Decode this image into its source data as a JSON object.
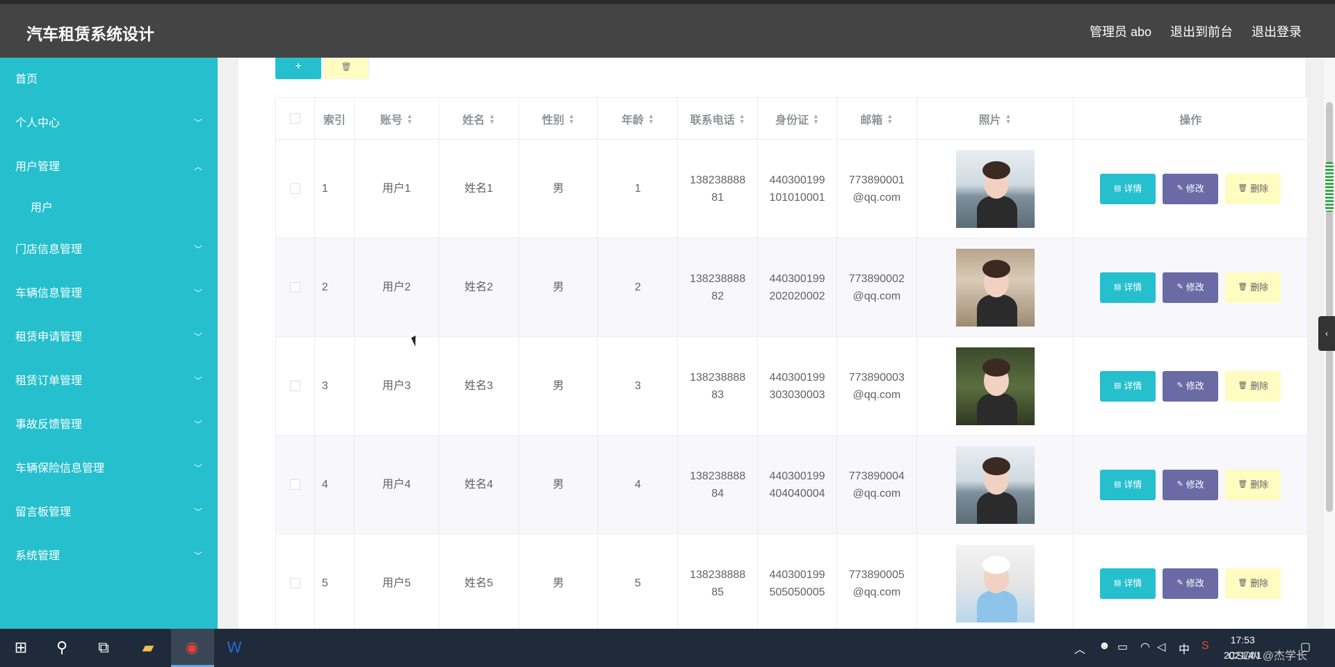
{
  "header": {
    "title": "汽车租赁系统设计",
    "nav": [
      "管理员 abo",
      "退出到前台",
      "退出登录"
    ]
  },
  "sidebar": {
    "items": [
      {
        "label": "首页",
        "chevron": ""
      },
      {
        "label": "个人中心",
        "chevron": "down"
      },
      {
        "label": "用户管理",
        "chevron": "up"
      },
      {
        "label": "用户",
        "chevron": "",
        "sub": true
      },
      {
        "label": "门店信息管理",
        "chevron": "down"
      },
      {
        "label": "车辆信息管理",
        "chevron": "down"
      },
      {
        "label": "租赁申请管理",
        "chevron": "down"
      },
      {
        "label": "租赁订单管理",
        "chevron": "down"
      },
      {
        "label": "事故反馈管理",
        "chevron": "down"
      },
      {
        "label": "车辆保险信息管理",
        "chevron": "down"
      },
      {
        "label": "留言板管理",
        "chevron": "down"
      },
      {
        "label": "系统管理",
        "chevron": "down"
      }
    ]
  },
  "toolbar": {
    "add_label": "+",
    "delete_icon": "trash-icon"
  },
  "table": {
    "columns": [
      "",
      "索引",
      "账号",
      "姓名",
      "性别",
      "年龄",
      "联系电话",
      "身份证",
      "邮箱",
      "照片",
      "操作"
    ],
    "sortable": [
      false,
      false,
      true,
      true,
      true,
      true,
      true,
      true,
      true,
      true,
      false
    ],
    "rows": [
      {
        "index": "1",
        "account": "用户1",
        "name": "姓名1",
        "gender": "男",
        "age": "1",
        "phone": "138238888\n81",
        "idcard": "440300199\n101010001",
        "email": "773890001\n@qq.com",
        "photo": "ph1"
      },
      {
        "index": "2",
        "account": "用户2",
        "name": "姓名2",
        "gender": "男",
        "age": "2",
        "phone": "138238888\n82",
        "idcard": "440300199\n202020002",
        "email": "773890002\n@qq.com",
        "photo": "ph2"
      },
      {
        "index": "3",
        "account": "用户3",
        "name": "姓名3",
        "gender": "男",
        "age": "3",
        "phone": "138238888\n83",
        "idcard": "440300199\n303030003",
        "email": "773890003\n@qq.com",
        "photo": "ph3"
      },
      {
        "index": "4",
        "account": "用户4",
        "name": "姓名4",
        "gender": "男",
        "age": "4",
        "phone": "138238888\n84",
        "idcard": "440300199\n404040004",
        "email": "773890004\n@qq.com",
        "photo": "ph1"
      },
      {
        "index": "5",
        "account": "用户5",
        "name": "姓名5",
        "gender": "男",
        "age": "5",
        "phone": "138238888\n85",
        "idcard": "440300199\n505050005",
        "email": "773890005\n@qq.com",
        "photo": "ph5"
      }
    ],
    "actions": [
      "详情",
      "修改",
      "删除"
    ]
  },
  "taskbar": {
    "time": "17:53",
    "date": "2021/4/1",
    "ime": "中",
    "watermark": "CSDN @杰学长"
  },
  "colors": {
    "accent": "#25bfcd",
    "header": "#444444",
    "edit": "#6a6aa5",
    "delete": "#fffcc2"
  }
}
